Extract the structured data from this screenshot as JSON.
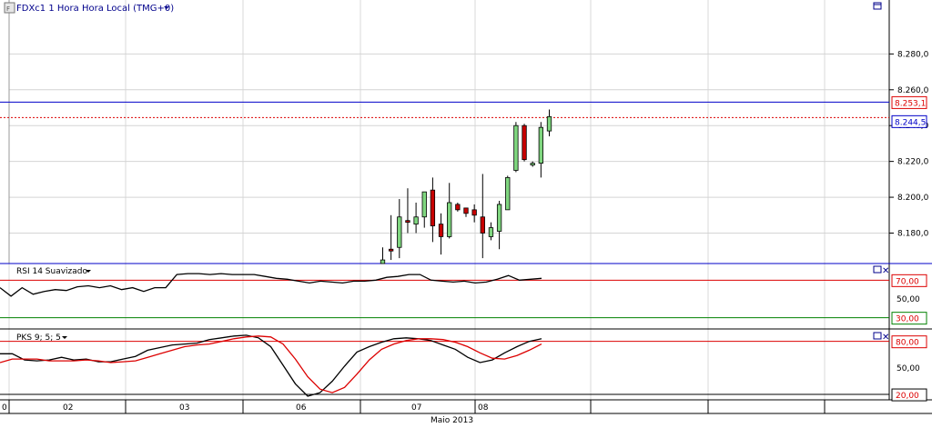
{
  "main_chart": {
    "title": "FDXc1 1 Hora Hora Local (TMG+0)",
    "current_label": "8.253,1",
    "level_label": "8.244,5",
    "dropdown_icon": "chevron-down-icon",
    "window_icon": "restore-window-icon"
  },
  "rsi_panel": {
    "title": "RSI 14 Suavizado",
    "overbought": "70,00",
    "mid": "50,00",
    "oversold": "30,00"
  },
  "pks_panel": {
    "title": "PKS 9; 5; 5",
    "upper": "80,00",
    "mid": "50,00",
    "lower": "20,00"
  },
  "time_axis": {
    "month_label": "Maio 2013",
    "day_labels": [
      "0",
      "02",
      "03",
      "06",
      "07",
      "08"
    ]
  },
  "colors": {
    "background": "#ffffff",
    "grid": "#d4d4d4",
    "blue_line": "#0000c8",
    "red_line": "#dc0000",
    "green_line": "#008000",
    "up_candle": "#7fd67f",
    "down_candle": "#c80000",
    "axis_text": "#000000",
    "title_blue": "#00008b"
  },
  "chart_data": [
    {
      "type": "candlestick",
      "title": "FDXc1 1 Hora Hora Local (TMG+0)",
      "ylim": [
        8163,
        8302
      ],
      "yticks": [
        "8.180,0",
        "8.200,0",
        "8.220,0",
        "8.240,0",
        "8.260,0",
        "8.280,0"
      ],
      "ytick_values": [
        8180,
        8200,
        8220,
        8240,
        8260,
        8280
      ],
      "hlines": [
        {
          "value": 8253.1,
          "label": "8.253,1",
          "style": "solid-blue"
        },
        {
          "value": 8244.5,
          "label": "8.244,5",
          "style": "dotted-red"
        }
      ],
      "ohlc": [
        {
          "o": 8160,
          "h": 8172,
          "l": 8160,
          "c": 8165
        },
        {
          "o": 8171,
          "h": 8190,
          "l": 8165,
          "c": 8170
        },
        {
          "o": 8172,
          "h": 8199,
          "l": 8166,
          "c": 8189
        },
        {
          "o": 8187,
          "h": 8205,
          "l": 8180,
          "c": 8186
        },
        {
          "o": 8185,
          "h": 8197,
          "l": 8180,
          "c": 8189
        },
        {
          "o": 8189,
          "h": 8201,
          "l": 8183,
          "c": 8203
        },
        {
          "o": 8204,
          "h": 8211,
          "l": 8175,
          "c": 8184
        },
        {
          "o": 8185,
          "h": 8191,
          "l": 8168,
          "c": 8178
        },
        {
          "o": 8178,
          "h": 8208,
          "l": 8177,
          "c": 8197
        },
        {
          "o": 8196,
          "h": 8197,
          "l": 8192,
          "c": 8193
        },
        {
          "o": 8194,
          "h": 8194,
          "l": 8189,
          "c": 8191
        },
        {
          "o": 8193,
          "h": 8196,
          "l": 8186,
          "c": 8190
        },
        {
          "o": 8189,
          "h": 8213,
          "l": 8166,
          "c": 8180
        },
        {
          "o": 8178,
          "h": 8186,
          "l": 8176,
          "c": 8183
        },
        {
          "o": 8181,
          "h": 8198,
          "l": 8171,
          "c": 8196
        },
        {
          "o": 8193,
          "h": 8212,
          "l": 8193,
          "c": 8211
        },
        {
          "o": 8215,
          "h": 8242,
          "l": 8214,
          "c": 8240
        },
        {
          "o": 8240,
          "h": 8241,
          "l": 8220,
          "c": 8221
        },
        {
          "o": 8218,
          "h": 8220,
          "l": 8217,
          "c": 8219
        },
        {
          "o": 8219,
          "h": 8242,
          "l": 8211,
          "c": 8239
        },
        {
          "o": 8237,
          "h": 8249,
          "l": 8234,
          "c": 8245
        }
      ]
    },
    {
      "type": "line",
      "title": "RSI 14 Suavizado",
      "ylim": [
        20,
        80
      ],
      "hlines": [
        70,
        30
      ],
      "yticks": [
        "70,00",
        "50,00",
        "30,00"
      ],
      "series": [
        {
          "name": "RSI 14 Suavizado",
          "values": [
            62,
            53,
            62,
            55,
            58,
            60,
            59,
            63,
            64,
            62,
            64,
            60,
            62,
            58,
            62,
            62,
            76,
            77,
            77,
            76,
            77,
            76,
            76,
            76,
            74,
            72,
            71,
            69,
            67,
            69,
            68,
            67,
            69,
            69,
            70,
            73,
            74,
            76,
            76,
            70,
            69,
            68,
            69,
            67,
            68,
            71,
            75,
            70,
            71,
            72
          ]
        }
      ]
    },
    {
      "type": "line",
      "title": "PKS 9; 5; 5",
      "ylim": [
        18,
        92
      ],
      "hlines": [
        80,
        20
      ],
      "yticks": [
        "80,00",
        "50,00",
        "20,00"
      ],
      "series": [
        {
          "name": "PKS 9; 5; 5",
          "values": [
            66,
            66,
            59,
            58,
            59,
            62,
            59,
            60,
            57,
            57,
            60,
            63,
            70,
            73,
            76,
            77,
            78,
            82,
            84,
            86,
            87,
            84,
            74,
            53,
            32,
            18,
            22,
            35,
            52,
            68,
            74,
            79,
            83,
            84,
            83,
            81,
            76,
            71,
            62,
            56,
            59,
            67,
            74,
            80,
            83
          ]
        },
        {
          "name": "",
          "values": [
            56,
            60,
            60,
            60,
            58,
            58,
            58,
            59,
            58,
            56,
            57,
            58,
            62,
            66,
            70,
            74,
            76,
            77,
            80,
            83,
            85,
            86,
            85,
            77,
            60,
            40,
            26,
            22,
            28,
            43,
            59,
            71,
            77,
            81,
            83,
            83,
            82,
            79,
            74,
            67,
            61,
            60,
            64,
            70,
            77
          ]
        }
      ]
    }
  ]
}
